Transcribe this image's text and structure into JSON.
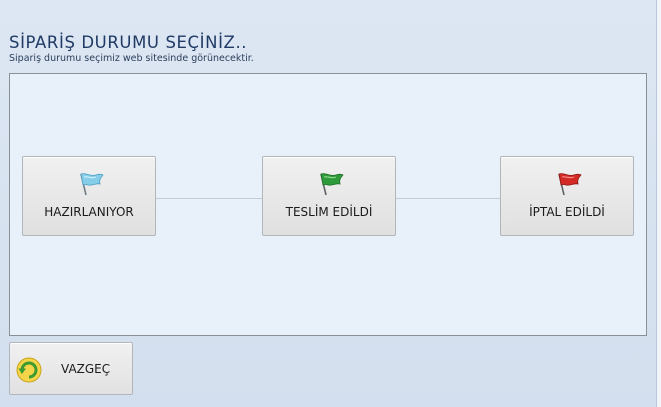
{
  "dialog": {
    "title": "SİPARİŞ DURUMU SEÇİNİZ..",
    "subtitle": "Sipariş durumu seçimiz web sitesinde görünecektir."
  },
  "statuses": [
    {
      "label": "HAZIRLANIYOR",
      "icon": "light-blue-flag-icon",
      "color": "#7fc7e6"
    },
    {
      "label": "TESLİM EDİLDİ",
      "icon": "green-flag-icon",
      "color": "#2f9a3a"
    },
    {
      "label": "İPTAL EDİLDİ",
      "icon": "red-flag-icon",
      "color": "#d42a25"
    }
  ],
  "cancel": {
    "label": "VAZGEÇ",
    "icon": "green-refresh-icon"
  }
}
